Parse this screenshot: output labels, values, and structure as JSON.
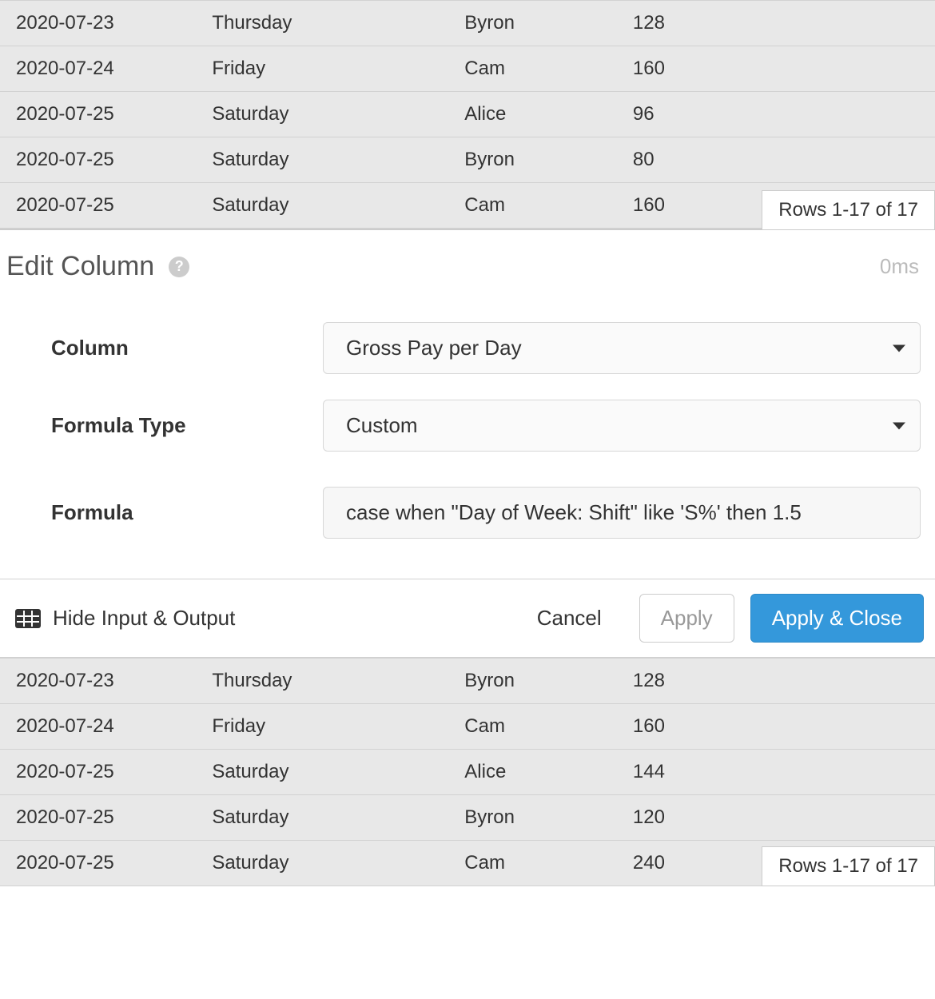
{
  "top_table": {
    "rows": [
      {
        "date": "2020-07-23",
        "day": "Thursday",
        "name": "Byron",
        "val": "128"
      },
      {
        "date": "2020-07-24",
        "day": "Friday",
        "name": "Cam",
        "val": "160"
      },
      {
        "date": "2020-07-25",
        "day": "Saturday",
        "name": "Alice",
        "val": "96"
      },
      {
        "date": "2020-07-25",
        "day": "Saturday",
        "name": "Byron",
        "val": "80"
      },
      {
        "date": "2020-07-25",
        "day": "Saturday",
        "name": "Cam",
        "val": "160"
      }
    ],
    "rows_badge": "Rows 1-17 of 17"
  },
  "panel": {
    "title": "Edit Column",
    "timing": "0ms",
    "column_label": "Column",
    "column_value": "Gross Pay per Day",
    "formula_type_label": "Formula Type",
    "formula_type_value": "Custom",
    "formula_label": "Formula",
    "formula_value": "case when \"Day of Week: Shift\" like 'S%' then 1.5"
  },
  "actions": {
    "hide_io": "Hide Input & Output",
    "cancel": "Cancel",
    "apply": "Apply",
    "apply_close": "Apply & Close"
  },
  "bottom_table": {
    "rows": [
      {
        "date": "2020-07-23",
        "day": "Thursday",
        "name": "Byron",
        "val": "128"
      },
      {
        "date": "2020-07-24",
        "day": "Friday",
        "name": "Cam",
        "val": "160"
      },
      {
        "date": "2020-07-25",
        "day": "Saturday",
        "name": "Alice",
        "val": "144"
      },
      {
        "date": "2020-07-25",
        "day": "Saturday",
        "name": "Byron",
        "val": "120"
      },
      {
        "date": "2020-07-25",
        "day": "Saturday",
        "name": "Cam",
        "val": "240"
      }
    ],
    "rows_badge": "Rows 1-17 of 17"
  }
}
